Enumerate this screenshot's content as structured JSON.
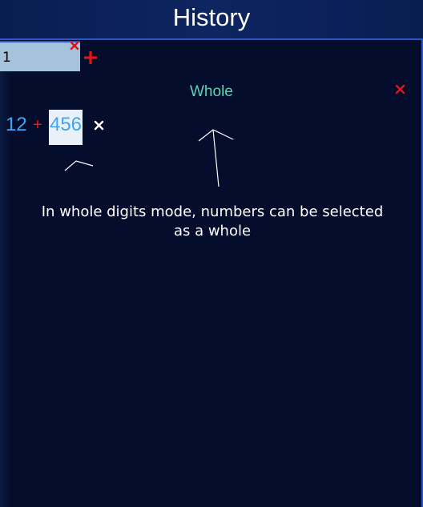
{
  "header": {
    "title": "History"
  },
  "tabs": [
    {
      "label": "1"
    }
  ],
  "icons": {
    "tab_close": "close-icon",
    "tab_add": "plus-icon",
    "panel_close": "close-icon",
    "expression_clear": "close-icon"
  },
  "panel": {
    "mode_label": "Whole"
  },
  "expression": {
    "operand_a": "12",
    "operator": "+",
    "operand_b": "456"
  },
  "annotation": {
    "text": "In whole digits mode, numbers can be selected as a whole"
  },
  "colors": {
    "background": "#050d2c",
    "header": "#0d2560",
    "accent_border": "#2e55c8",
    "tab_selected": "#a5c3dc",
    "mode_label": "#5ed1b1",
    "number": "#3da5f4",
    "operator": "#e02020",
    "close_red": "#e01515"
  }
}
